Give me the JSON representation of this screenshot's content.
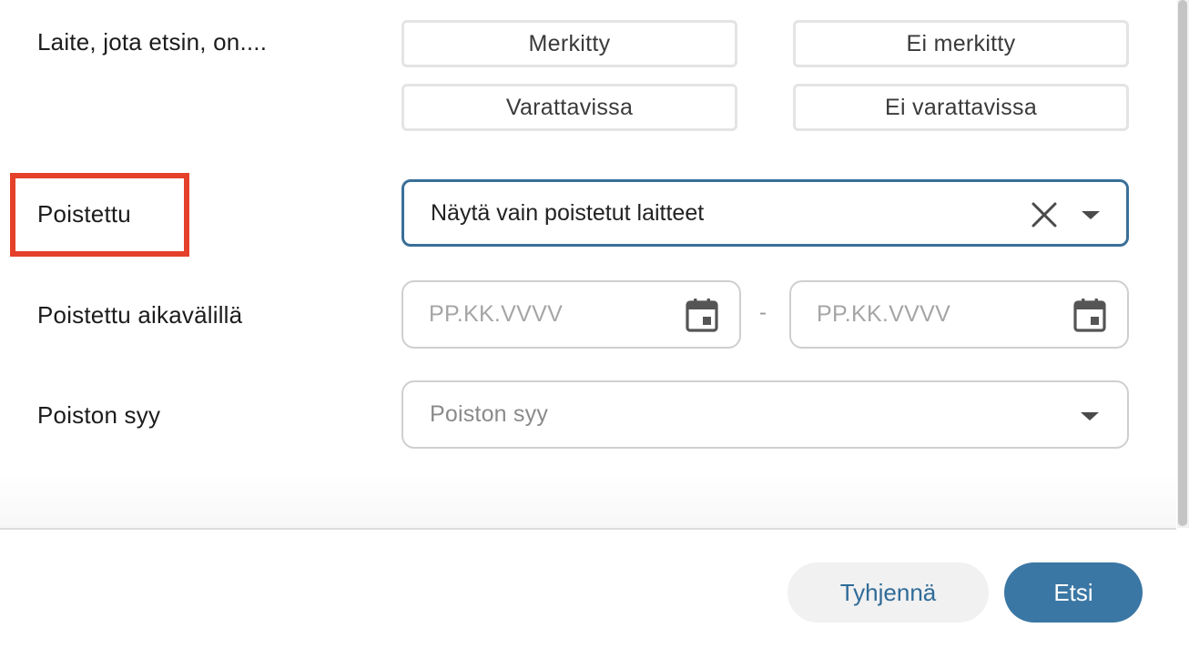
{
  "filters": {
    "device_status": {
      "label": "Laite, jota etsin, on....",
      "options": [
        "Merkitty",
        "Ei merkitty",
        "Varattavissa",
        "Ei varattavissa"
      ]
    },
    "deleted": {
      "label": "Poistettu",
      "selected_value": "Näytä vain poistetut laitteet"
    },
    "deleted_range": {
      "label": "Poistettu aikavälillä",
      "start_placeholder": "PP.KK.VVVV",
      "separator": "-",
      "end_placeholder": "PP.KK.VVVV"
    },
    "deletion_reason": {
      "label": "Poiston syy",
      "placeholder": "Poiston syy"
    }
  },
  "footer": {
    "clear_label": "Tyhjennä",
    "search_label": "Etsi"
  },
  "colors": {
    "highlight_box": "#e5412a",
    "select_border": "#3a6f98",
    "primary_button": "#3b77a4",
    "clear_button_text": "#2f6b98"
  },
  "icons": {
    "clear": "close-icon",
    "dropdown": "chevron-down-icon",
    "date": "calendar-icon"
  }
}
